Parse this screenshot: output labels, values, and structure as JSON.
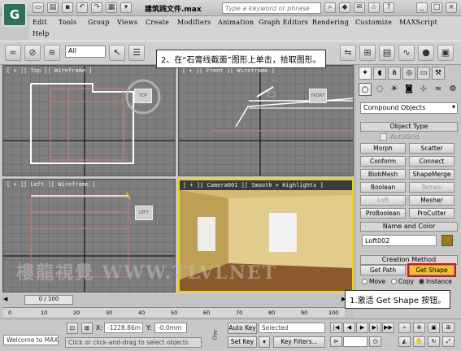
{
  "app": {
    "logo_glyph": "G",
    "window_title": "建筑践文件.max",
    "search_placeholder": "Type a keyword or phrase"
  },
  "menu": [
    "Edit",
    "Tools",
    "Group",
    "Views",
    "Create",
    "Modifiers",
    "Animation",
    "Graph Editors",
    "Rendering",
    "Customize",
    "MAXScript",
    "Help"
  ],
  "toolbar": {
    "filter_value": "All"
  },
  "callouts": {
    "step2": "2、在“石膏线截面”图形上单击，拾取图形。",
    "step1": "1.激活 Get Shape 按钮。"
  },
  "viewports": {
    "top": {
      "label": "[ + ][ Top ][ Wireframe ]",
      "cube": "TOP"
    },
    "front": {
      "label": "[ + ][ Front ][ Wireframe ]",
      "cube": "FRONT"
    },
    "left": {
      "label": "[ + ][ Left ][ Wireframe ]",
      "cube": "LEFT"
    },
    "camera": {
      "label": "[ + ][ Camera001 ][ Smooth + Highlights ]"
    }
  },
  "command_panel": {
    "category": "Compound Objects",
    "object_type": {
      "header": "Object Type",
      "autogrid": "AutoGrid",
      "buttons": [
        {
          "label": "Morph",
          "enabled": true
        },
        {
          "label": "Scatter",
          "enabled": true
        },
        {
          "label": "Conform",
          "enabled": true
        },
        {
          "label": "Connect",
          "enabled": true
        },
        {
          "label": "BlobMesh",
          "enabled": true
        },
        {
          "label": "ShapeMerge",
          "enabled": true
        },
        {
          "label": "Boolean",
          "enabled": true
        },
        {
          "label": "Terrain",
          "enabled": false
        },
        {
          "label": "Loft",
          "enabled": false
        },
        {
          "label": "Mesher",
          "enabled": true
        },
        {
          "label": "ProBoolean",
          "enabled": true
        },
        {
          "label": "ProCutter",
          "enabled": true
        }
      ]
    },
    "name_color": {
      "header": "Name and Color",
      "name": "Loft002",
      "swatch": "#a07a10"
    },
    "creation_method": {
      "header": "Creation Method",
      "get_path": "Get Path",
      "get_shape": "Get Shape",
      "options": [
        "Move",
        "Copy",
        "Instance"
      ],
      "selected": "Instance"
    }
  },
  "timeline": {
    "frame_display": "0 / 100",
    "ticks": [
      "0",
      "10",
      "20",
      "30",
      "40",
      "50",
      "60",
      "70",
      "80",
      "90",
      "100"
    ]
  },
  "status": {
    "listener": "Welcome to MAX!",
    "x_label": "X:",
    "x_value": "-1228.86m",
    "y_label": "Y:",
    "y_value": "-0.0mm",
    "prompt": "Click or click-and-drag to select objects",
    "auto_key": "Auto Key",
    "set_key": "Set Key",
    "key_mode": "Selected",
    "key_filters": "Key Filters..."
  },
  "watermark": "樓龍視覺 WWW.TLVLNET",
  "colors": {
    "get_shape_active": "#f0c030",
    "highlight_red": "#e01010",
    "viewport_active_border": "#f2d500"
  }
}
